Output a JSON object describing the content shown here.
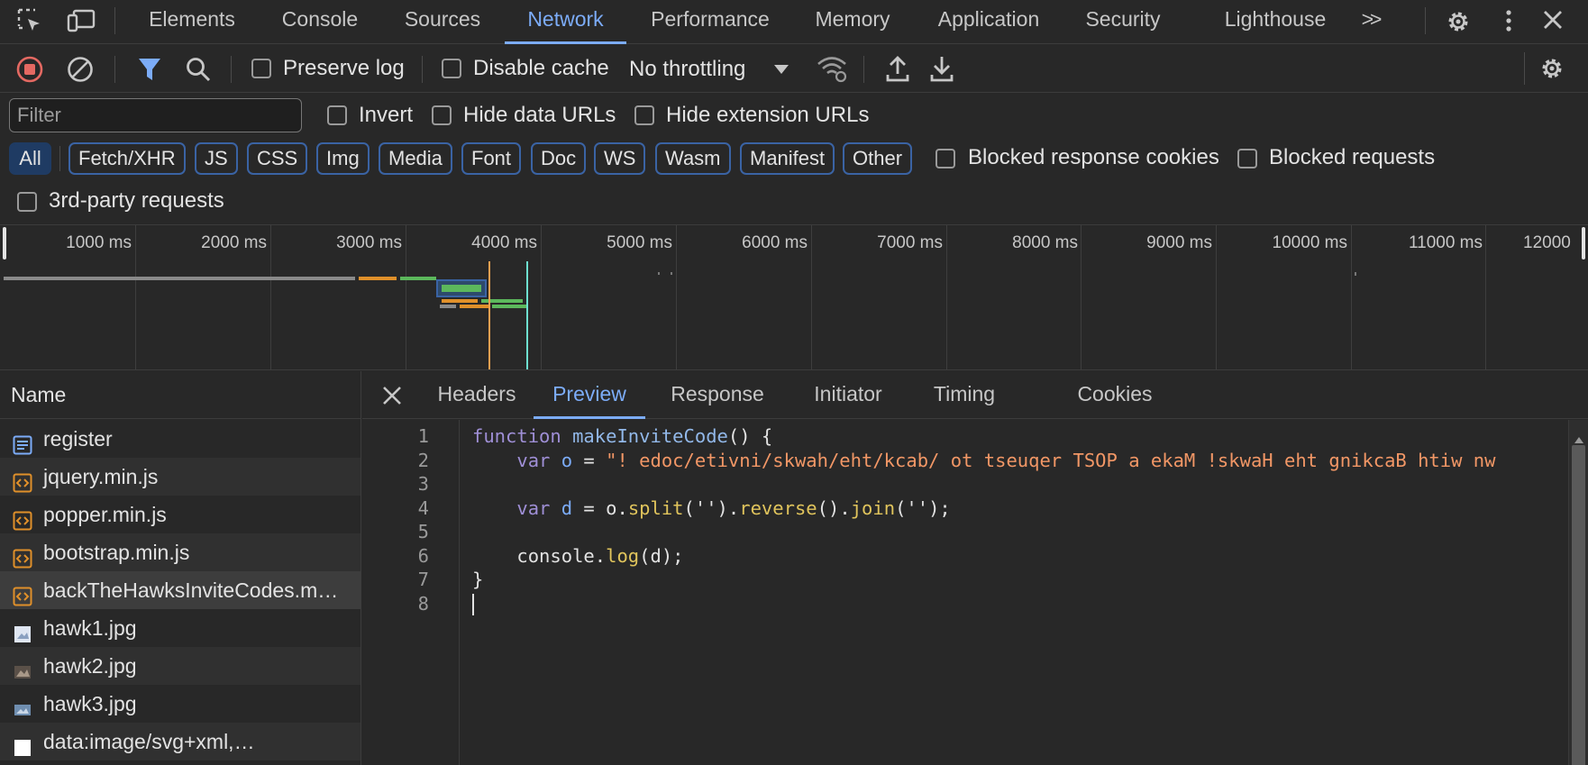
{
  "tabs": {
    "items": [
      "Elements",
      "Console",
      "Sources",
      "Network",
      "Performance",
      "Memory",
      "Application",
      "Security",
      "Lighthouse"
    ],
    "active": "Network",
    "more_label": ">>"
  },
  "toolbar": {
    "preserve_log": "Preserve log",
    "disable_cache": "Disable cache",
    "throttling": "No throttling"
  },
  "filter": {
    "placeholder": "Filter",
    "invert": "Invert",
    "hide_data_urls": "Hide data URLs",
    "hide_extension_urls": "Hide extension URLs",
    "types": [
      "All",
      "Fetch/XHR",
      "JS",
      "CSS",
      "Img",
      "Media",
      "Font",
      "Doc",
      "WS",
      "Wasm",
      "Manifest",
      "Other"
    ],
    "active_type": "All",
    "blocked_response_cookies": "Blocked response cookies",
    "blocked_requests": "Blocked requests",
    "third_party": "3rd-party requests"
  },
  "overview": {
    "ticks": [
      "1000 ms",
      "2000 ms",
      "3000 ms",
      "4000 ms",
      "5000 ms",
      "6000 ms",
      "7000 ms",
      "8000 ms",
      "9000 ms",
      "10000 ms",
      "11000 ms",
      "12000"
    ]
  },
  "requests": {
    "header": "Name",
    "items": [
      {
        "name": "register",
        "icon": "document-icon"
      },
      {
        "name": "jquery.min.js",
        "icon": "script-icon"
      },
      {
        "name": "popper.min.js",
        "icon": "script-icon"
      },
      {
        "name": "bootstrap.min.js",
        "icon": "script-icon"
      },
      {
        "name": "backTheHawksInviteCodes.m…",
        "icon": "script-icon"
      },
      {
        "name": "hawk1.jpg",
        "icon": "image-icon"
      },
      {
        "name": "hawk2.jpg",
        "icon": "image-icon"
      },
      {
        "name": "hawk3.jpg",
        "icon": "image-icon"
      },
      {
        "name": "data:image/svg+xml,…",
        "icon": "svg-icon"
      }
    ],
    "selected_index": 4
  },
  "detail": {
    "tabs": [
      "Headers",
      "Preview",
      "Response",
      "Initiator",
      "Timing",
      "Cookies"
    ],
    "active": "Preview"
  },
  "code": {
    "line_numbers": [
      "1",
      "2",
      "3",
      "4",
      "5",
      "6",
      "7",
      "8"
    ],
    "tokens": {
      "function": "function",
      "fn_name": "makeInviteCode",
      "parens_open": "() {",
      "var": "var",
      "o": "o",
      "eq": " = ",
      "reversed_string": "\"! edoc/etivni/skwah/eht/kcab/ ot tseuqer TSOP a ekaM !skwaH eht gnikcaB htiw nw",
      "d": "d",
      "o_dot": " = o.",
      "split": "split",
      "split_args": "('').",
      "reverse": "reverse",
      "reverse_args": "().",
      "join": "join",
      "join_args": "('');",
      "console": "console.",
      "log": "log",
      "log_args": "(d);",
      "close_brace": "}"
    }
  },
  "colors": {
    "accent": "#7cacf8",
    "record_red": "#e46962",
    "active_chip": "#1f3b63"
  }
}
